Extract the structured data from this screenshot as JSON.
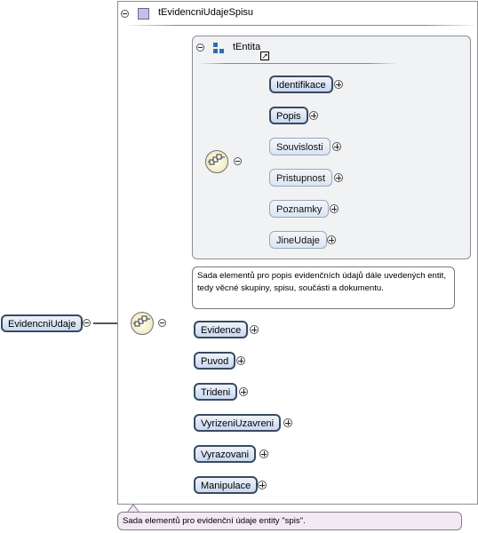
{
  "outer_type": {
    "name": "tEvidencniUdajeSpisu"
  },
  "inner_type": {
    "name": "tEntita"
  },
  "root": {
    "label": "EvidencniUdaje"
  },
  "inner_elements": [
    {
      "label": "Identifikace",
      "bold": true
    },
    {
      "label": "Popis",
      "bold": true
    },
    {
      "label": "Souvislosti",
      "bold": false
    },
    {
      "label": "Pristupnost",
      "bold": false
    },
    {
      "label": "Poznamky",
      "bold": false
    },
    {
      "label": "JineUdaje",
      "bold": false
    }
  ],
  "outer_elements": [
    {
      "label": "Evidence"
    },
    {
      "label": "Puvod"
    },
    {
      "label": "Trideni"
    },
    {
      "label": "VyrizeniUzavreni"
    },
    {
      "label": "Vyrazovani"
    },
    {
      "label": "Manipulace"
    }
  ],
  "notes": {
    "entity_note": "Sada elementů pro popis evidenčních údajů dále uvedených entit, tedy věcné skupiny, spisu, součásti a dokumentu.",
    "type_note": "Sada elementů pro evidenční údaje entity \"spis\"."
  },
  "colors": {
    "element_fill": "#c9d9ef",
    "element_border": "#394a60",
    "sequence_fill": "#ece4b7",
    "type_icon": "#c9bde8",
    "entity_icon": "#2f6fb0",
    "note_pink": "#f3e9f5"
  }
}
